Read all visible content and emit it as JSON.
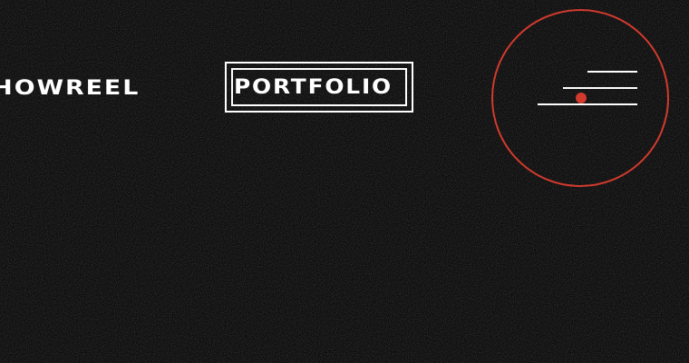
{
  "nav": {
    "items": [
      {
        "label": "SHOWREEL"
      },
      {
        "label": "PORTFOLIO",
        "active": true
      }
    ]
  },
  "menu": {
    "icon": "hamburger-menu-icon",
    "accent_color": "#d23a2e"
  },
  "theme": {
    "background": "#0b0b0b",
    "foreground": "#ffffff",
    "accent": "#d23a2e"
  }
}
